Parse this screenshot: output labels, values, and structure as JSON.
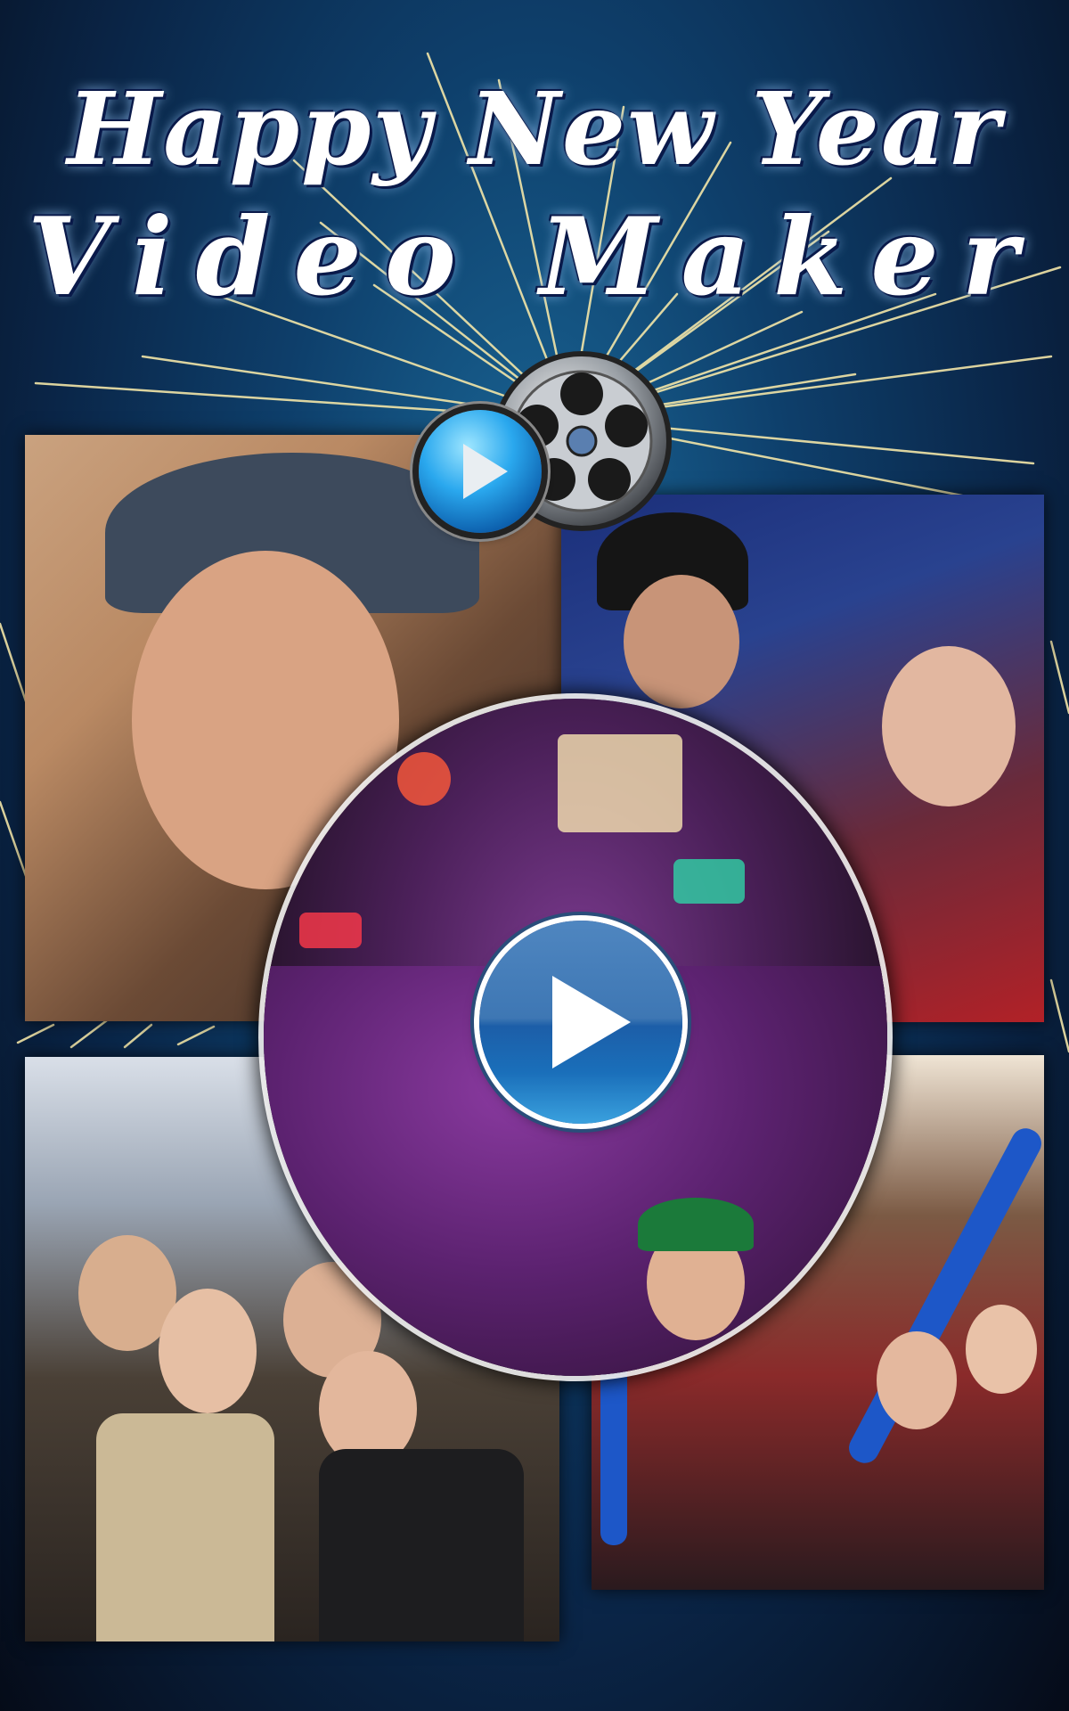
{
  "title": {
    "line1": "Happy New Year",
    "line2": "Video Maker"
  },
  "icons": {
    "film_reel": "film-reel-icon",
    "small_play": "play-icon",
    "big_play": "play-button-icon"
  },
  "colors": {
    "background_top": "#0e3f6b",
    "background_bottom": "#050b18",
    "firework": "#f3e6a8",
    "play_blue": "#1c5ea8",
    "title_text": "#ffffff"
  }
}
